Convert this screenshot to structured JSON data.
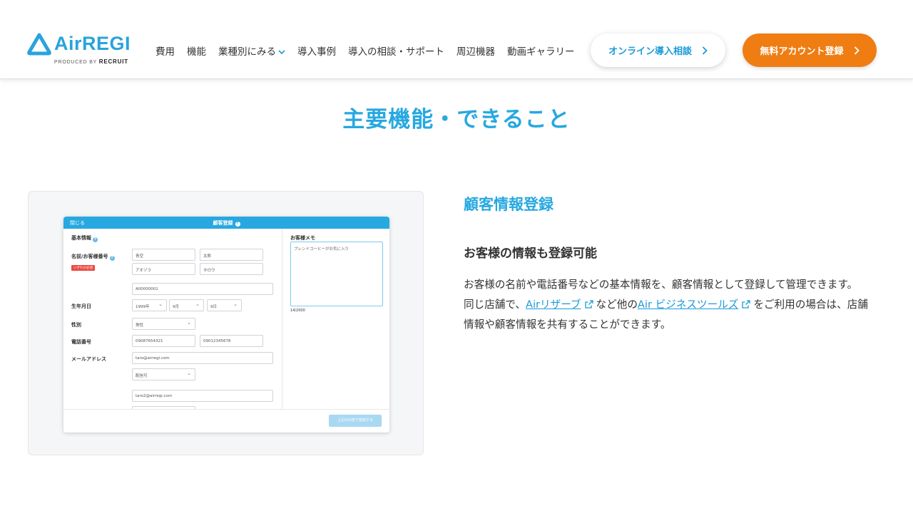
{
  "brand": {
    "logo_text": "AirREGI",
    "produced_by": "PRODUCED BY",
    "company": "RECRUIT",
    "color": "#2aa3dd"
  },
  "nav": {
    "items": [
      "費用",
      "機能",
      "業種別にみる",
      "導入事例",
      "導入の相談・サポート",
      "周辺機器",
      "動画ギャラリー"
    ]
  },
  "cta": {
    "consult_label": "オンライン導入相談",
    "signup_label": "無料アカウント登録",
    "signup_color": "#ef7d12"
  },
  "section": {
    "title": "主要機能・できること"
  },
  "screenshot": {
    "modal_close": "閉じる",
    "modal_title": "顧客登録",
    "basic_info": "基本情報",
    "name_label": "名前/お客様番号",
    "required_badge": "いずれか必須",
    "last_name": "青空",
    "first_name": "太郎",
    "last_kana": "アオゾラ",
    "first_kana": "タロウ",
    "customer_no": "A00000001",
    "birthday_label": "生年月日",
    "birth_year": "1999年",
    "birth_month": "9月",
    "birth_day": "9日",
    "gender_label": "性別",
    "gender": "男性",
    "phone_label": "電話番号",
    "phone1": "09087654321",
    "phone2": "09012345678",
    "email_label": "メールアドレス",
    "email1": "taro@airregi.com",
    "delivery": "配信可",
    "email2": "taro2@airregi.com",
    "memo_label": "お客様メモ",
    "memo_text": "ブレンドコーヒーがお気に入り",
    "memo_count": "14/2000",
    "save_button": "上記の内容で登録する"
  },
  "info": {
    "title": "顧客情報登録",
    "subtitle": "お客様の情報も登録可能",
    "para1": "お客様の名前や電話番号などの基本情報を、顧客情報として登録して管理できます。",
    "para2_a": "同じ店舗で、",
    "link1": "Airリザーブ",
    "para2_b": "など他の",
    "link2": "Air ビジネスツールズ",
    "para2_c": "をご利用の場合は、店舗情報や顧客情報を共有することができます。"
  },
  "icons": {
    "logo": "airregi-logo-icon",
    "nav_dropdown": "chevron-down-icon",
    "button_arrow": "chevron-right-icon",
    "external_link": "external-link-icon"
  }
}
